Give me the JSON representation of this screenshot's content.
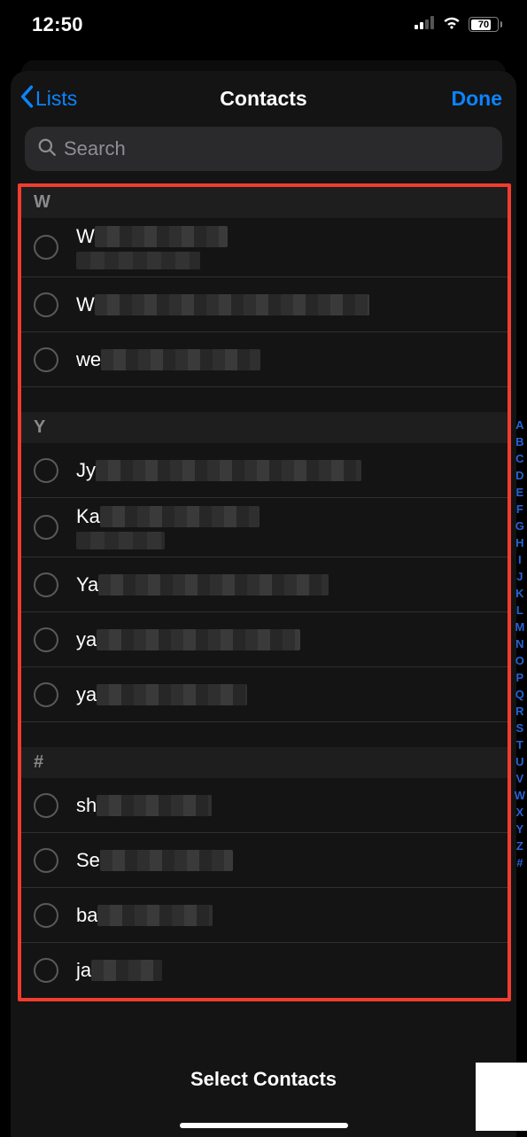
{
  "status": {
    "time": "12:50",
    "battery_pct": "70"
  },
  "nav": {
    "back_label": "Lists",
    "title": "Contacts",
    "done_label": "Done"
  },
  "search": {
    "placeholder": "Search"
  },
  "sections": [
    {
      "letter": "W",
      "rows": [
        {
          "prefix": "W",
          "blur_w": 150,
          "sub_blur_w": 140
        },
        {
          "prefix": "W",
          "blur_w": 310,
          "sub_blur_w": 0
        },
        {
          "prefix": "we",
          "blur_w": 180,
          "sub_blur_w": 0
        }
      ]
    },
    {
      "letter": "Y",
      "rows": [
        {
          "prefix": "Jy",
          "blur_w": 300,
          "sub_blur_w": 0
        },
        {
          "prefix": "Ka",
          "blur_w": 180,
          "sub_blur_w": 100
        },
        {
          "prefix": "Ya",
          "blur_w": 260,
          "sub_blur_w": 0
        },
        {
          "prefix": "ya",
          "blur_w": 230,
          "sub_blur_w": 0
        },
        {
          "prefix": "ya",
          "blur_w": 170,
          "sub_blur_w": 0
        }
      ]
    },
    {
      "letter": "#",
      "rows": [
        {
          "prefix": "sh",
          "blur_w": 130,
          "sub_blur_w": 0
        },
        {
          "prefix": "Se",
          "blur_w": 150,
          "sub_blur_w": 0
        },
        {
          "prefix": "ba",
          "blur_w": 130,
          "sub_blur_w": 0
        },
        {
          "prefix": "ja",
          "blur_w": 80,
          "sub_blur_w": 0
        }
      ]
    }
  ],
  "index_letters": [
    "A",
    "B",
    "C",
    "D",
    "E",
    "F",
    "G",
    "H",
    "I",
    "J",
    "K",
    "L",
    "M",
    "N",
    "O",
    "P",
    "Q",
    "R",
    "S",
    "T",
    "U",
    "V",
    "W",
    "X",
    "Y",
    "Z",
    "#"
  ],
  "footer": {
    "label": "Select Contacts"
  }
}
